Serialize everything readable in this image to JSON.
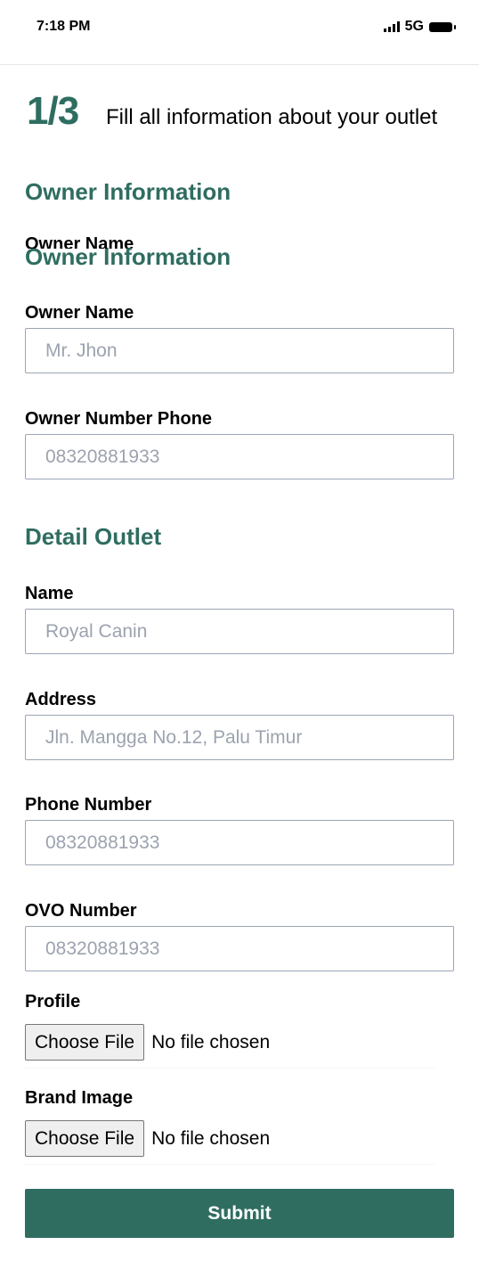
{
  "status_bar": {
    "time": "7:18 PM",
    "network": "5G"
  },
  "header": {
    "step": "1/3",
    "description": "Fill all information about your outlet"
  },
  "owner_section": {
    "title": "Owner Information",
    "overlap_label": "Owner Name",
    "overlap_title": "Owner Information",
    "owner_name_label": "Owner Name",
    "owner_name_placeholder": "Mr. Jhon",
    "owner_phone_label": "Owner Number Phone",
    "owner_phone_placeholder": "08320881933"
  },
  "outlet_section": {
    "title": "Detail Outlet",
    "name_label": "Name",
    "name_placeholder": "Royal Canin",
    "address_label": "Address",
    "address_placeholder": "Jln. Mangga No.12, Palu Timur",
    "phone_label": "Phone Number",
    "phone_placeholder": "08320881933",
    "ovo_label": "OVO Number",
    "ovo_placeholder": "08320881933",
    "profile_label": "Profile",
    "brand_label": "Brand Image",
    "choose_file": "Choose File",
    "no_file": "No file chosen"
  },
  "submit_label": "Submit",
  "colors": {
    "accent": "#2f6d61"
  }
}
